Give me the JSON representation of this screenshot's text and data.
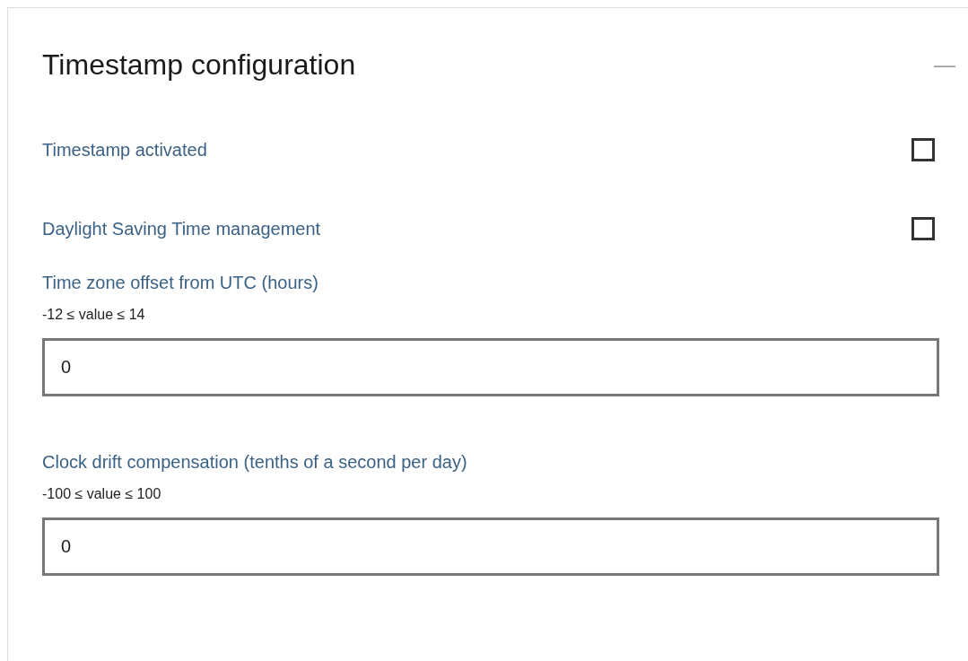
{
  "panel": {
    "title": "Timestamp configuration",
    "collapse_icon": "—",
    "expanded": true
  },
  "settings": [
    {
      "kind": "checkbox",
      "label": "Timestamp activated",
      "checked": false
    },
    {
      "kind": "checkbox",
      "label": "Daylight Saving Time management",
      "checked": false
    },
    {
      "kind": "number",
      "label": "Time zone offset from UTC (hours)",
      "range": "-12 ≤ value ≤ 14",
      "value": "0"
    },
    {
      "kind": "number",
      "label": "Clock drift compensation (tenths of a second per day)",
      "range": "-100 ≤ value ≤ 100",
      "value": "0"
    }
  ]
}
